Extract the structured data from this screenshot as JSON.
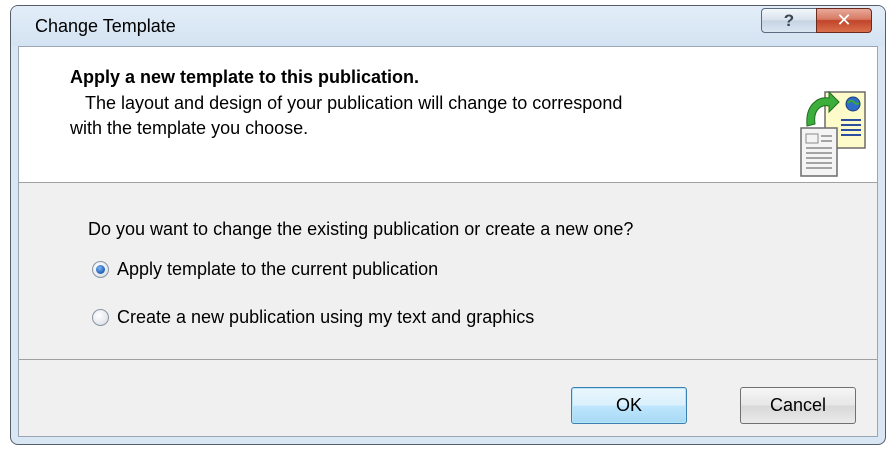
{
  "window": {
    "title": "Change Template",
    "help_button": "?",
    "close_button": "✕"
  },
  "header": {
    "title": "Apply a new template to this publication.",
    "description_line1": "The layout and design of your publication will change to correspond",
    "description_line2": "with the template you choose.",
    "icon": "change-template-icon"
  },
  "body": {
    "question": "Do you want to change the existing publication or create a new one?",
    "options": [
      {
        "label": "Apply template to the current publication",
        "selected": true
      },
      {
        "label": "Create a new publication using my text and graphics",
        "selected": false
      }
    ]
  },
  "buttons": {
    "ok": "OK",
    "cancel": "Cancel"
  },
  "colors": {
    "frame": "#d9e6f3",
    "close_button": "#c1442a",
    "default_button_border": "#3c7fb1",
    "radio_selected": "#2d6fc4"
  }
}
